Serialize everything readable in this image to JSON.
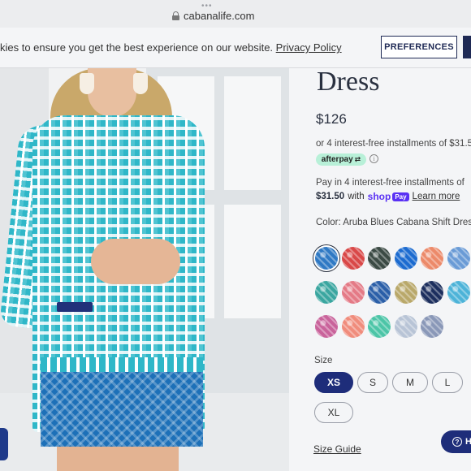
{
  "browser": {
    "url": "cabanalife.com"
  },
  "cookie_banner": {
    "text": "kies to ensure you get the best experience on our website. ",
    "link": "Privacy Policy",
    "preferences_label": "PREFERENCES"
  },
  "product": {
    "title": "Dress",
    "price": "$126",
    "installments_text": "or 4 interest-free installments of $31.5",
    "afterpay_label": "afterpay",
    "info_glyph": "i",
    "shoppay_line1": "Pay in 4 interest-free installments of",
    "shoppay_amount": "$31.50",
    "shoppay_with": "with",
    "shop_logo": "shop",
    "pay_chip": "Pay",
    "learn_more": "Learn more",
    "color_label": "Color: Aruba Blues Cabana Shift Dress"
  },
  "swatches": [
    {
      "color": "#2f79c4"
    },
    {
      "color": "#d94848"
    },
    {
      "color": "#3b4a44"
    },
    {
      "color": "#1c6bd0"
    },
    {
      "color": "#ec8a6a"
    },
    {
      "color": "#6a9bd6"
    },
    {
      "color": "#3aa6a0"
    },
    {
      "color": "#e47a86"
    },
    {
      "color": "#2b5fa8"
    },
    {
      "color": "#b9a86a"
    },
    {
      "color": "#1d2f5e"
    },
    {
      "color": "#4db3d8"
    },
    {
      "color": "#c9639b"
    },
    {
      "color": "#f08c7c"
    },
    {
      "color": "#4cc5a7"
    },
    {
      "color": "#b8c4d6"
    },
    {
      "color": "#8a98b8"
    }
  ],
  "sizes": {
    "label": "Size",
    "options": [
      "XS",
      "S",
      "M",
      "L",
      "XL"
    ],
    "selected": "XS",
    "guide": "Size Guide"
  },
  "help": {
    "label": "H"
  }
}
